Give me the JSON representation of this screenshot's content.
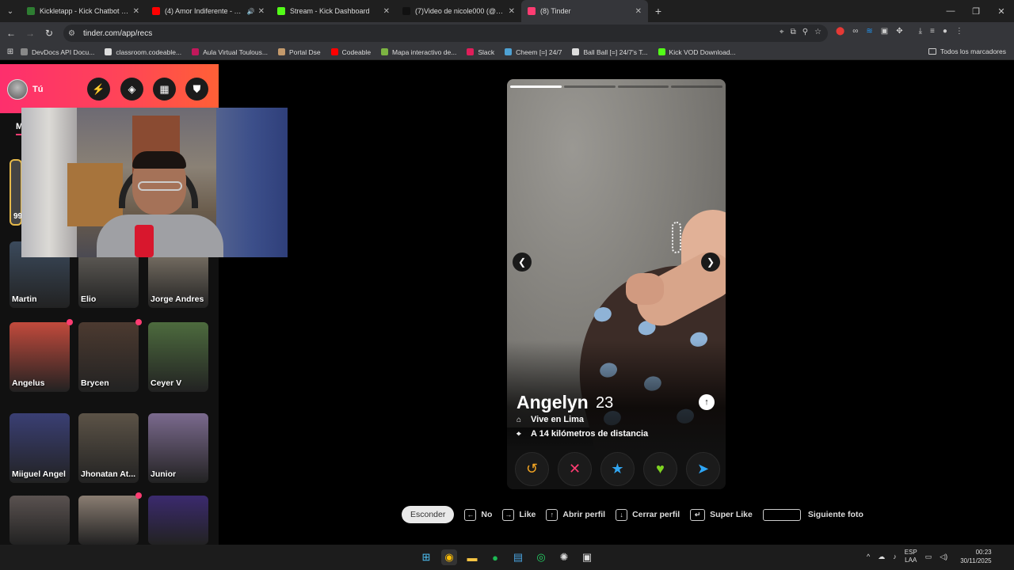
{
  "browser": {
    "tabs": [
      {
        "title": "Kickletapp - Kick Chatbot and",
        "color": "#2e7d32",
        "active": false,
        "audio": false
      },
      {
        "title": "(4) Amor Indiferente - YouT",
        "color": "#ff0000",
        "active": false,
        "audio": true
      },
      {
        "title": "Stream - Kick Dashboard",
        "color": "#53fc18",
        "active": false,
        "audio": false
      },
      {
        "title": "(7)Video de nicole000 (@userd",
        "color": "#111111",
        "active": false,
        "audio": false
      },
      {
        "title": "(8) Tinder",
        "color": "#fe3c72",
        "active": true,
        "audio": false
      }
    ],
    "new_tab": "+",
    "url": "tinder.com/app/recs",
    "bookmarks": [
      {
        "label": "DevDocs API Docu...",
        "color": "#888888"
      },
      {
        "label": "classroom.codeable...",
        "color": "#dddddd"
      },
      {
        "label": "Aula Virtual Toulous...",
        "color": "#c2185b"
      },
      {
        "label": "Portal Dse",
        "color": "#c49a6c"
      },
      {
        "label": "Codeable",
        "color": "#ff0000"
      },
      {
        "label": "Mapa interactivo de...",
        "color": "#7cb342"
      },
      {
        "label": "Slack",
        "color": "#e01e5a"
      },
      {
        "label": "Cheem [=] 24/7",
        "color": "#4ea1d3"
      },
      {
        "label": "Ball Ball [=] 24/7's T...",
        "color": "#dddddd"
      },
      {
        "label": "Kick VOD Download...",
        "color": "#53fc18"
      }
    ],
    "all_bookmarks": "Todos los marcadores"
  },
  "sidebar": {
    "user_label": "Tú",
    "tab_letter": "M",
    "first_count": "99",
    "header_buttons": [
      {
        "name": "boost-button",
        "glyph": "⚡"
      },
      {
        "name": "explore-button",
        "glyph": "◈"
      },
      {
        "name": "gifts-button",
        "glyph": "▦"
      },
      {
        "name": "safety-button",
        "glyph": "⛊"
      }
    ],
    "matches": [
      {
        "name": "Martin",
        "color": "#3b4a5c",
        "new": false
      },
      {
        "name": "Elio",
        "color": "#6a6660",
        "new": false
      },
      {
        "name": "Jorge Andres",
        "color": "#8a8072",
        "new": false
      },
      {
        "name": "Angelus",
        "color": "#c24a3c",
        "new": true
      },
      {
        "name": "Brycen",
        "color": "#4c3a30",
        "new": true
      },
      {
        "name": "Ceyer V",
        "color": "#4d6b3e",
        "new": false
      },
      {
        "name": "Miiguel Angel",
        "color": "#3a3f74",
        "new": false
      },
      {
        "name": "Jhonatan At...",
        "color": "#5c5347",
        "new": false
      },
      {
        "name": "Junior",
        "color": "#7b6a8e",
        "new": false
      },
      {
        "name": "",
        "color": "#5a5250",
        "new": false
      },
      {
        "name": "",
        "color": "#8a7d72",
        "new": true
      },
      {
        "name": "",
        "color": "#3b2a6e",
        "new": false
      }
    ]
  },
  "profile": {
    "name": "Angelyn",
    "age": "23",
    "lives": "Vive en Lima",
    "distance": "A 14 kilómetros de distancia",
    "photo_count": 4,
    "current_photo": 1
  },
  "actions": [
    {
      "name": "rewind-button",
      "glyph": "↺",
      "color": "#f5a623"
    },
    {
      "name": "nope-button",
      "glyph": "✕",
      "color": "#fe3c72"
    },
    {
      "name": "superlike-button",
      "glyph": "★",
      "color": "#31a5ef"
    },
    {
      "name": "like-button",
      "glyph": "♥",
      "color": "#7ed321"
    },
    {
      "name": "boost-send-button",
      "glyph": "➤",
      "color": "#2ea6f6"
    }
  ],
  "shortcuts": {
    "hide": "Esconder",
    "no": "No",
    "like": "Like",
    "open": "Abrir perfil",
    "close": "Cerrar perfil",
    "superlike": "Super Like",
    "next": "Siguiente foto"
  },
  "taskbar": {
    "lang_1": "ESP",
    "lang_2": "LAA",
    "time": "00:23",
    "date": "30/11/2025"
  }
}
